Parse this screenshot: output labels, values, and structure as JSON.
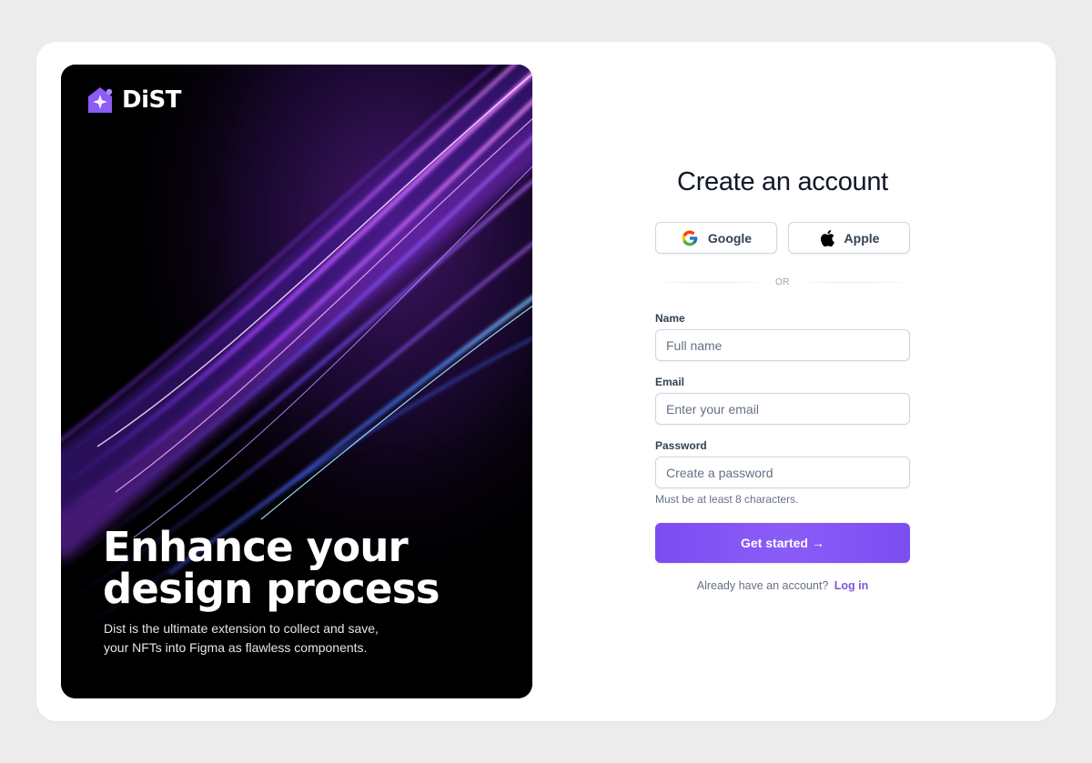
{
  "brand": {
    "name": "DiST",
    "logo_icon": "dist-logo-icon",
    "accent": "#8b5cf6"
  },
  "hero": {
    "title": "Enhance your design process",
    "subtitle": "Dist is the ultimate extension to collect and save, your NFTs into Figma as flawless components."
  },
  "form": {
    "title": "Create an account",
    "social": [
      {
        "label": "Google",
        "icon": "google-icon"
      },
      {
        "label": "Apple",
        "icon": "apple-icon"
      }
    ],
    "divider": "OR",
    "fields": {
      "name": {
        "label": "Name",
        "placeholder": "Full name",
        "value": ""
      },
      "email": {
        "label": "Email",
        "placeholder": "Enter your email",
        "value": ""
      },
      "password": {
        "label": "Password",
        "placeholder": "Create a password",
        "value": "",
        "hint": "Must be at least 8 characters."
      }
    },
    "submit": {
      "label": "Get started",
      "icon": "arrow-right-icon",
      "arrow": "→"
    },
    "login": {
      "prompt": "Already have an account?",
      "link": "Log in"
    }
  }
}
